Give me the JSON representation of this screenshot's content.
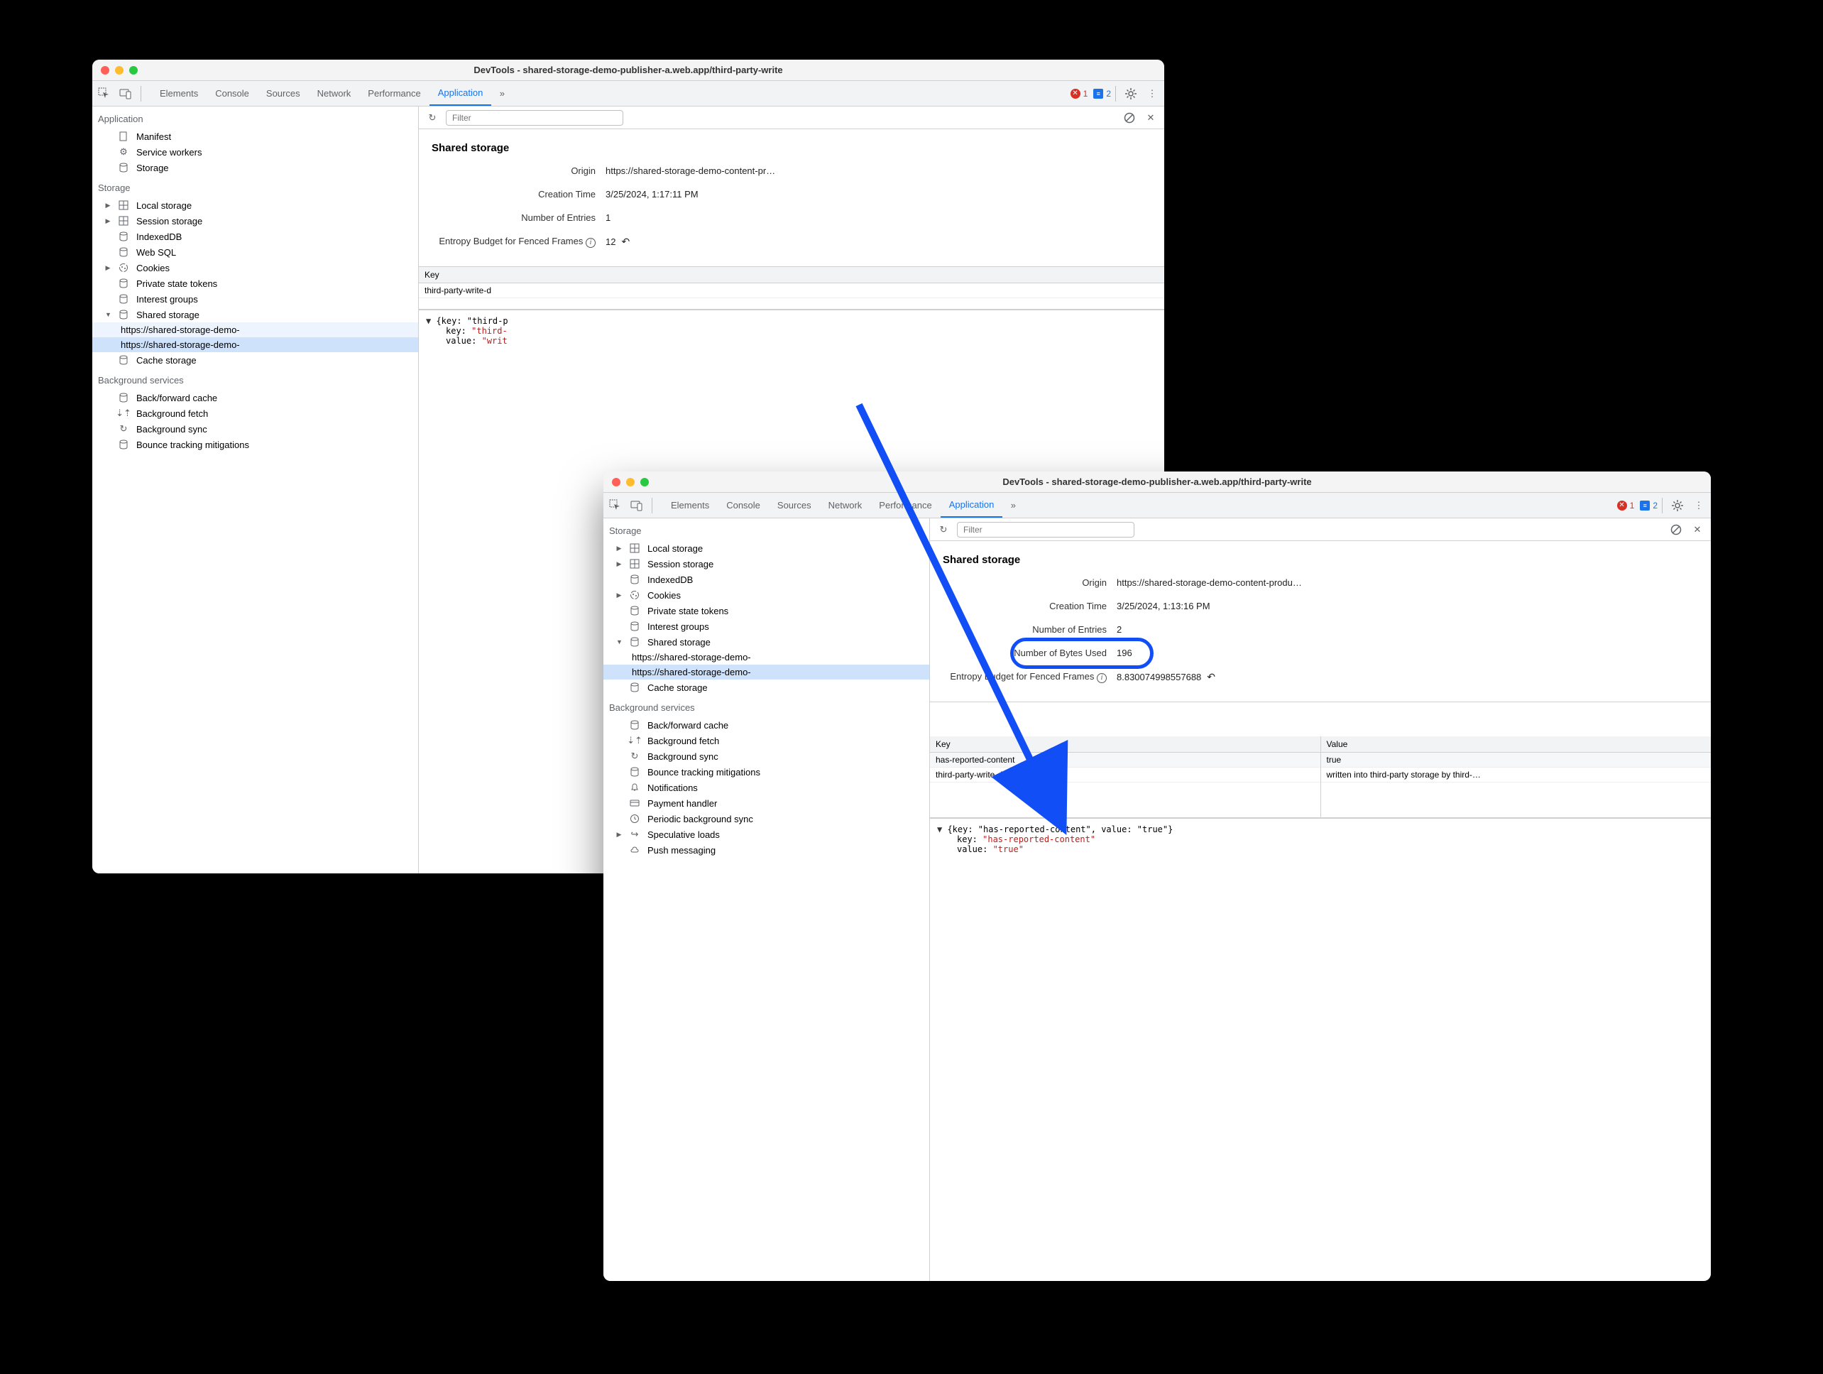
{
  "windows": [
    {
      "title": "DevTools - shared-storage-demo-publisher-a.web.app/third-party-write",
      "tabs": [
        "Elements",
        "Console",
        "Sources",
        "Network",
        "Performance",
        "Application"
      ],
      "active_tab": "Application",
      "errors": 1,
      "messages": 2,
      "filter_placeholder": "Filter",
      "sidebar": {
        "sections": [
          {
            "title": "Application",
            "items": [
              {
                "icon": "file",
                "label": "Manifest"
              },
              {
                "icon": "gears",
                "label": "Service workers"
              },
              {
                "icon": "db",
                "label": "Storage"
              }
            ]
          },
          {
            "title": "Storage",
            "items": [
              {
                "icon": "grid",
                "label": "Local storage",
                "arrow": "right"
              },
              {
                "icon": "grid",
                "label": "Session storage",
                "arrow": "right"
              },
              {
                "icon": "db",
                "label": "IndexedDB"
              },
              {
                "icon": "db",
                "label": "Web SQL"
              },
              {
                "icon": "cookie",
                "label": "Cookies",
                "arrow": "right"
              },
              {
                "icon": "db",
                "label": "Private state tokens"
              },
              {
                "icon": "db",
                "label": "Interest groups"
              },
              {
                "icon": "db",
                "label": "Shared storage",
                "arrow": "down",
                "children": [
                  {
                    "label": "https://shared-storage-demo-",
                    "url": true
                  },
                  {
                    "label": "https://shared-storage-demo-",
                    "url": true,
                    "selected": true
                  }
                ]
              },
              {
                "icon": "db",
                "label": "Cache storage"
              }
            ]
          },
          {
            "title": "Background services",
            "items": [
              {
                "icon": "db",
                "label": "Back/forward cache"
              },
              {
                "icon": "fetch",
                "label": "Background fetch"
              },
              {
                "icon": "sync",
                "label": "Background sync"
              },
              {
                "icon": "db",
                "label": "Bounce tracking mitigations"
              }
            ]
          }
        ]
      },
      "panel": {
        "heading": "Shared storage",
        "rows": [
          {
            "k": "Origin",
            "v": "https://shared-storage-demo-content-pr…"
          },
          {
            "k": "Creation Time",
            "v": "3/25/2024, 1:17:11 PM"
          },
          {
            "k": "Number of Entries",
            "v": "1"
          },
          {
            "k": "Entropy Budget for Fenced Frames",
            "v": "12",
            "info": true,
            "undo": true
          }
        ],
        "table": {
          "headers": [
            "Key"
          ],
          "rows": [
            [
              "third-party-write-d"
            ]
          ]
        },
        "json": {
          "pre": "{key: \"third-p",
          "keyLabel": "key: ",
          "key": "\"third-",
          "valLabel": "value: ",
          "val": "\"writ"
        }
      }
    },
    {
      "title": "DevTools - shared-storage-demo-publisher-a.web.app/third-party-write",
      "tabs": [
        "Elements",
        "Console",
        "Sources",
        "Network",
        "Performance",
        "Application"
      ],
      "active_tab": "Application",
      "errors": 1,
      "messages": 2,
      "filter_placeholder": "Filter",
      "sidebar": {
        "sections": [
          {
            "title": "Storage",
            "items": [
              {
                "icon": "grid",
                "label": "Local storage",
                "arrow": "right"
              },
              {
                "icon": "grid",
                "label": "Session storage",
                "arrow": "right"
              },
              {
                "icon": "db",
                "label": "IndexedDB"
              },
              {
                "icon": "cookie",
                "label": "Cookies",
                "arrow": "right"
              },
              {
                "icon": "db",
                "label": "Private state tokens"
              },
              {
                "icon": "db",
                "label": "Interest groups"
              },
              {
                "icon": "db",
                "label": "Shared storage",
                "arrow": "down",
                "children": [
                  {
                    "label": "https://shared-storage-demo-",
                    "url": true
                  },
                  {
                    "label": "https://shared-storage-demo-",
                    "url": true,
                    "selected": true
                  }
                ]
              },
              {
                "icon": "db",
                "label": "Cache storage"
              }
            ]
          },
          {
            "title": "Background services",
            "items": [
              {
                "icon": "db",
                "label": "Back/forward cache"
              },
              {
                "icon": "fetch",
                "label": "Background fetch"
              },
              {
                "icon": "sync",
                "label": "Background sync"
              },
              {
                "icon": "db",
                "label": "Bounce tracking mitigations"
              },
              {
                "icon": "bell",
                "label": "Notifications"
              },
              {
                "icon": "card",
                "label": "Payment handler"
              },
              {
                "icon": "clock",
                "label": "Periodic background sync"
              },
              {
                "icon": "arrow",
                "label": "Speculative loads",
                "arrow": "right"
              },
              {
                "icon": "cloud",
                "label": "Push messaging"
              }
            ]
          }
        ]
      },
      "panel": {
        "heading": "Shared storage",
        "rows": [
          {
            "k": "Origin",
            "v": "https://shared-storage-demo-content-produ…"
          },
          {
            "k": "Creation Time",
            "v": "3/25/2024, 1:13:16 PM"
          },
          {
            "k": "Number of Entries",
            "v": "2"
          },
          {
            "k": "Number of Bytes Used",
            "v": "196",
            "highlight": true
          },
          {
            "k": "Entropy Budget for Fenced Frames",
            "v": "8.830074998557688",
            "info": true,
            "undo": true
          }
        ],
        "table": {
          "headers": [
            "Key",
            "Value"
          ],
          "rows": [
            [
              "has-reported-content",
              "true"
            ],
            [
              "third-party-write-demo",
              "written into third-party storage by third-…"
            ]
          ]
        },
        "json": {
          "pre": "{key: \"has-reported-content\", value: \"true\"}",
          "keyLabel": "key: ",
          "key": "\"has-reported-content\"",
          "valLabel": "value: ",
          "val": "\"true\""
        }
      }
    }
  ]
}
